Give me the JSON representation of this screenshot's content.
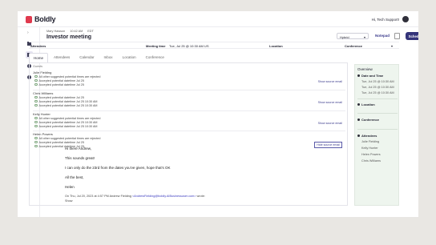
{
  "app": {
    "name": "Boldly",
    "user": "Hi, Tech Support!"
  },
  "header": {
    "assignee": "Mary Hawson",
    "time": "10:42 AM",
    "tz": "EDT",
    "title": "Investor meeting",
    "mode": "Hybrid",
    "notepad": "Notepad",
    "schedule_btn": "Schedule meeting"
  },
  "infobar": {
    "attendees": "Attendees",
    "meeting_time_label": "Meeting time",
    "meeting_time_value": "Tue, Jul 25 @ 10:30 AM US",
    "location": "Location",
    "conference": "Conference"
  },
  "tabs": [
    "Home",
    "Attendees",
    "Calendar",
    "Inbox",
    "Location",
    "Conference"
  ],
  "thread_label": "Guests",
  "threads": [
    {
      "name": "Julie Fielding",
      "lines": [
        "All other suggested potential times are rejected",
        "Accepted potential datetime Jul 25",
        "Accepted potential datetime Jul 25"
      ],
      "link": "Show source email"
    },
    {
      "name": "Chris Williams",
      "lines": [
        "Accepted potential datetime Jul 25",
        "Accepted potential datetime Jul 25 10:30 AM",
        "Accepted potential datetime Jul 25 10:30 AM"
      ],
      "link": "Show source email"
    },
    {
      "name": "Kelly Hunter",
      "lines": [
        "All other suggested potential times are rejected",
        "Accepted potential datetime Jul 25 10:30 AM",
        "Accepted potential datetime Jul 25 10:30 AM"
      ],
      "link": "Show source email"
    },
    {
      "name": "Helen Powers",
      "lines": [
        "All other suggested potential times are rejected",
        "Accepted potential datetime Jul 25",
        "Accepted potential datetime Jul 25"
      ],
      "link": "Hide source email"
    }
  ],
  "email": {
    "greeting": "Hi there Andrew,",
    "line1": "This sounds great!",
    "line2": "I can only do the 23rd from the dates you've given, hope that's OK",
    "closing": "All the best,",
    "signature": "Helen",
    "quote_prefix": "On Thu, Jul 20, 2023 at 4:57 PM Andrew Fielding ",
    "quote_link": "<AndrewFielding@boldly.AIBusinessuser.com>",
    "quote_suffix": " wrote:",
    "show": "Show"
  },
  "overview": {
    "title": "Overview",
    "date_label": "Date and Time",
    "dates": [
      "Tue, Jul 25 @ 10:30 AM",
      "Tue, Jul 25 @ 10:30 AM",
      "Tue, Jul 25 @ 10:30 AM"
    ],
    "location_label": "Location",
    "conference_label": "Conference",
    "attendees_label": "Attendees",
    "attendees": [
      "Julie Fielding",
      "Kelly Hunter",
      "Helen Powers",
      "Chris Williams"
    ]
  }
}
